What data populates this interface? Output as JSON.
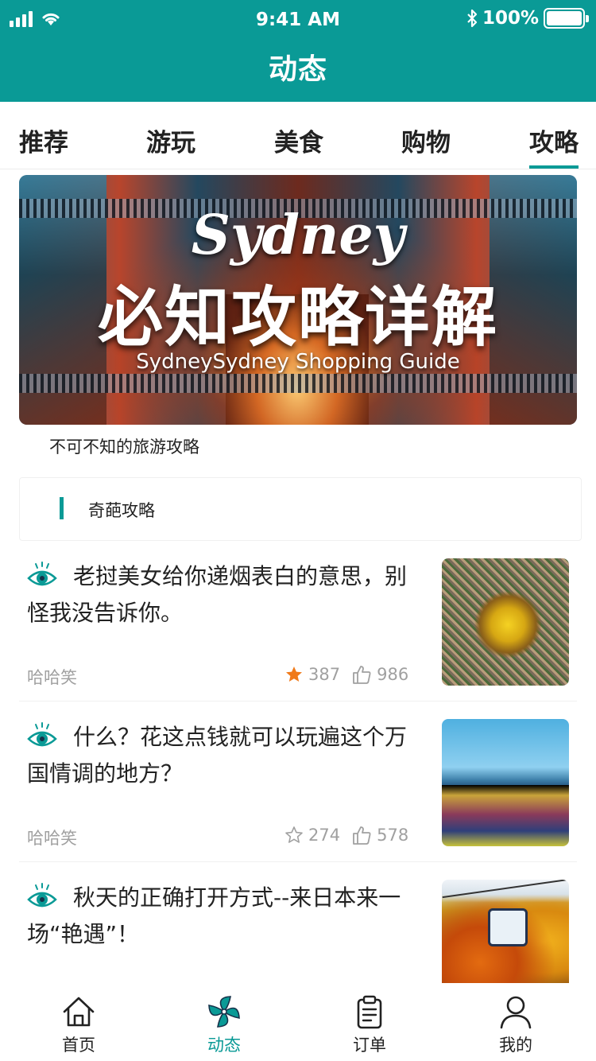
{
  "status_bar": {
    "time": "9:41 AM",
    "battery": "100%"
  },
  "header": {
    "title": "动态"
  },
  "tabs": [
    {
      "label": "推荐",
      "active": false
    },
    {
      "label": "游玩",
      "active": false
    },
    {
      "label": "美食",
      "active": false
    },
    {
      "label": "购物",
      "active": false
    },
    {
      "label": "攻略",
      "active": true
    }
  ],
  "banner": {
    "script_text": "Sydney",
    "headline": "必知攻略详解",
    "subline": "SydneySydney Shopping Guide",
    "caption": "不可不知的旅游攻略"
  },
  "section": {
    "title": "奇葩攻略"
  },
  "articles": [
    {
      "title": "老挝美女给你递烟表白的意思，别怪我没告诉你。",
      "author": "哈哈笑",
      "stars": "387",
      "likes": "986",
      "starred": true,
      "thumb": "temple-aerial"
    },
    {
      "title": "什么？花这点钱就可以玩遍这个万国情调的地方？",
      "author": "哈哈笑",
      "stars": "274",
      "likes": "578",
      "starred": false,
      "thumb": "castle-town"
    },
    {
      "title": "秋天的正确打开方式--来日本来一场“艳遇”！",
      "author": "",
      "stars": "",
      "likes": "",
      "starred": false,
      "thumb": "autumn-gondola"
    }
  ],
  "bottom_nav": [
    {
      "label": "首页",
      "icon": "home-icon",
      "active": false
    },
    {
      "label": "动态",
      "icon": "pinwheel-icon",
      "active": true
    },
    {
      "label": "订单",
      "icon": "clipboard-icon",
      "active": false
    },
    {
      "label": "我的",
      "icon": "user-icon",
      "active": false
    }
  ],
  "colors": {
    "accent": "#0a9a96",
    "star_active": "#f07a1a",
    "muted": "#a0a0a0"
  }
}
